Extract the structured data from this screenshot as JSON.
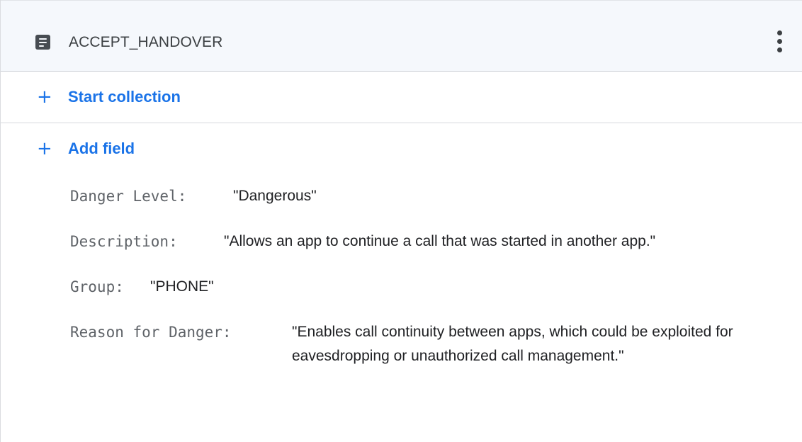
{
  "document": {
    "title": "ACCEPT_HANDOVER",
    "icon": "document-icon",
    "menu_icon": "more-vert-icon"
  },
  "actions": {
    "start_collection_label": "Start collection",
    "add_field_label": "Add field",
    "plus_icon": "+"
  },
  "fields": [
    {
      "key": "Danger Level:",
      "value": "\"Dangerous\""
    },
    {
      "key": "Description:",
      "value": "\"Allows an app to continue a call that was started in another app.\""
    },
    {
      "key": "Group:",
      "value": "\"PHONE\""
    },
    {
      "key": "Reason for Danger:",
      "value": "\"Enables call continuity between apps, which could be exploited for eavesdropping or unauthorized call management.\""
    }
  ],
  "colors": {
    "accent": "#1a73e8",
    "header_bg": "#f5f8fc",
    "key_text": "#5f6368",
    "value_text": "#202124"
  }
}
